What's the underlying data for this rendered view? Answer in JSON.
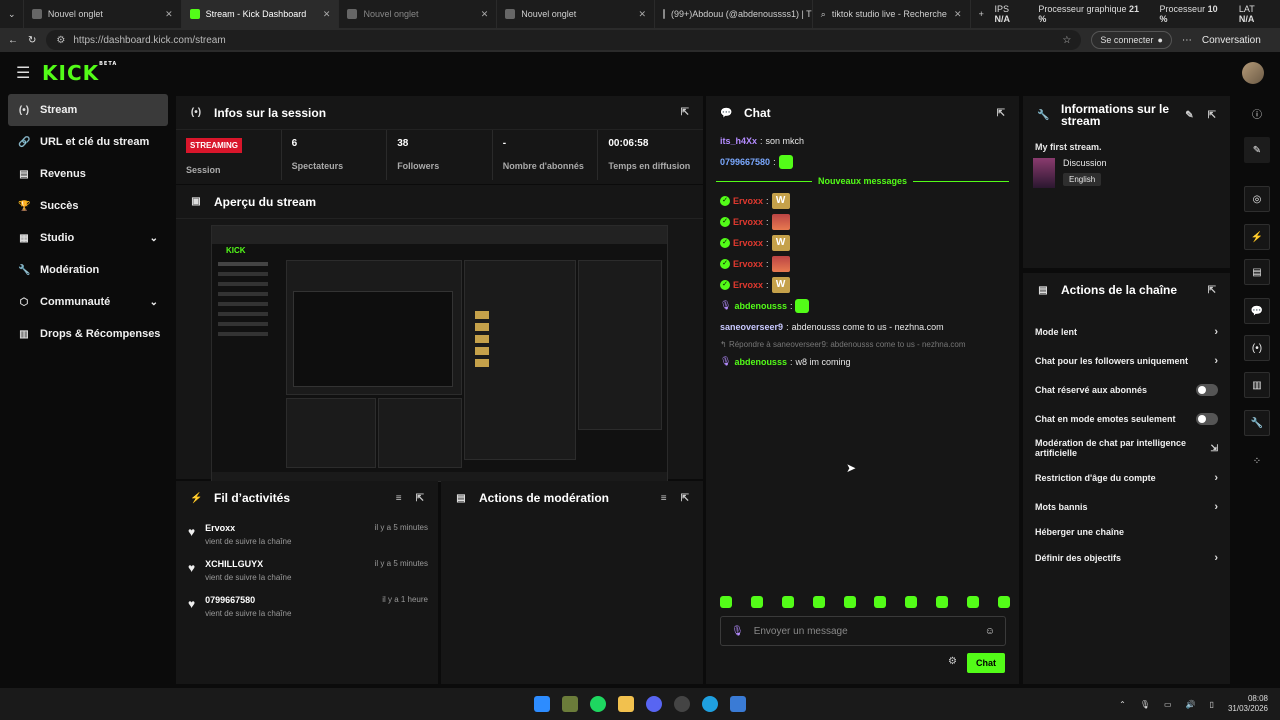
{
  "browser": {
    "tabs": [
      {
        "label": "Nouvel onglet"
      },
      {
        "label": "Stream - Kick Dashboard"
      },
      {
        "label": "Nouvel onglet"
      },
      {
        "label": "Nouvel onglet"
      },
      {
        "label": "(99+)Abdouu (@abdenoussss1) | T"
      },
      {
        "label": "tiktok studio live - Recherche"
      }
    ],
    "url": "https://dashboard.kick.com/stream",
    "connect_label": "Se connecter",
    "conversation_label": "Conversation",
    "stats": {
      "ips_label": "IPS",
      "ips_value": "N/A",
      "gpu_label": "Processeur graphique",
      "gpu_value": "21 %",
      "cpu_label": "Processeur",
      "cpu_value": "10 %",
      "lat_label": "LAT",
      "lat_value": "N/A"
    }
  },
  "app": {
    "logo": "KICK",
    "logo_sup": "BETA"
  },
  "sidebar": {
    "items": [
      {
        "label": "Stream"
      },
      {
        "label": "URL et clé du stream"
      },
      {
        "label": "Revenus"
      },
      {
        "label": "Succès"
      },
      {
        "label": "Studio"
      },
      {
        "label": "Modération"
      },
      {
        "label": "Communauté"
      },
      {
        "label": "Drops & Récompenses"
      }
    ]
  },
  "session": {
    "title": "Infos sur la session",
    "status_badge": "STREAMING",
    "session_label": "Session",
    "viewers_value": "6",
    "viewers_label": "Spectateurs",
    "followers_value": "38",
    "followers_label": "Followers",
    "subs_value": "-",
    "subs_label": "Nombre d'abonnés",
    "time_value": "00:06:58",
    "time_label": "Temps en diffusion"
  },
  "preview": {
    "title": "Aperçu du stream"
  },
  "activity": {
    "title": "Fil d’activités",
    "items": [
      {
        "name": "Ervoxx",
        "sub": "vient de suivre la chaîne",
        "time": "il y a 5 minutes"
      },
      {
        "name": "XCHILLGUYX",
        "sub": "vient de suivre la chaîne",
        "time": "il y a 5 minutes"
      },
      {
        "name": "0799667580",
        "sub": "vient de suivre la chaîne",
        "time": "il y a 1 heure"
      }
    ]
  },
  "moderation": {
    "title": "Actions de modération"
  },
  "chat": {
    "title": "Chat",
    "msg1_user": "its_h4Xx",
    "msg1_text": "son mkch",
    "msg2_user": "0799667580",
    "new_messages": "Nouveaux messages",
    "ervoxx_user": "Ervoxx",
    "abd_user": "abdenousss",
    "sane_user": "saneoverseer9",
    "sane_text": "abdenousss come to us - nezhna.com",
    "reply_hint": "Répondre à saneoverseer9: abdenousss come to us - nezhna.com",
    "abd2_user": "abdenousss",
    "abd2_text": "w8 im coming",
    "input_placeholder": "Envoyer un message",
    "send_label": "Chat"
  },
  "stream_info": {
    "title": "Informations sur le stream",
    "stream_title": "My first stream.",
    "category": "Discussion",
    "language": "English"
  },
  "channel_actions": {
    "title": "Actions de la chaîne",
    "items": [
      {
        "label": "Mode lent"
      },
      {
        "label": "Chat pour les followers uniquement"
      },
      {
        "label": "Chat réservé aux abonnés"
      },
      {
        "label": "Chat en mode emotes seulement"
      },
      {
        "label": "Modération de chat par intelligence artificielle"
      },
      {
        "label": "Restriction d'âge du compte"
      },
      {
        "label": "Mots bannis"
      },
      {
        "label": "Héberger une chaîne"
      },
      {
        "label": "Définir des objectifs"
      }
    ]
  },
  "taskbar": {
    "time": "08:08",
    "date": "31/03/2026"
  }
}
